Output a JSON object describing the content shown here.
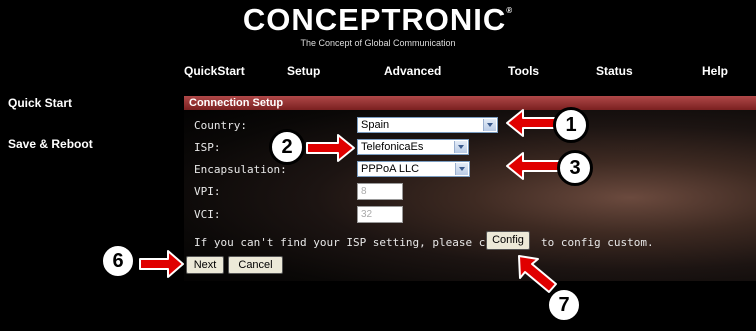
{
  "brand": {
    "logo": "CONCEPTRONIC",
    "trademark": "®",
    "tagline": "The Concept of Global Communication"
  },
  "menu": {
    "items": [
      "QuickStart",
      "Setup",
      "Advanced",
      "Tools",
      "Status",
      "Help"
    ]
  },
  "sidebar": {
    "items": [
      "Quick Start",
      "Save & Reboot"
    ]
  },
  "panel": {
    "title": "Connection Setup",
    "fields": {
      "country": {
        "label": "Country:",
        "value": "Spain"
      },
      "isp": {
        "label": "ISP:",
        "value": "TelefonicaEs"
      },
      "encapsulation": {
        "label": "Encapsulation:",
        "value": "PPPoA LLC"
      },
      "vpi": {
        "label": "VPI:",
        "value": "8"
      },
      "vci": {
        "label": "VCI:",
        "value": "32"
      }
    },
    "note_before": "If you can't find your ISP setting, please click",
    "note_after": "to config custom.",
    "config_button": "Config",
    "next_button": "Next",
    "cancel_button": "Cancel"
  },
  "callouts": [
    "1",
    "2",
    "3",
    "6",
    "7"
  ],
  "colors": {
    "panel_title": "#9a3030",
    "arrow": "#e00000",
    "background": "#000000"
  }
}
